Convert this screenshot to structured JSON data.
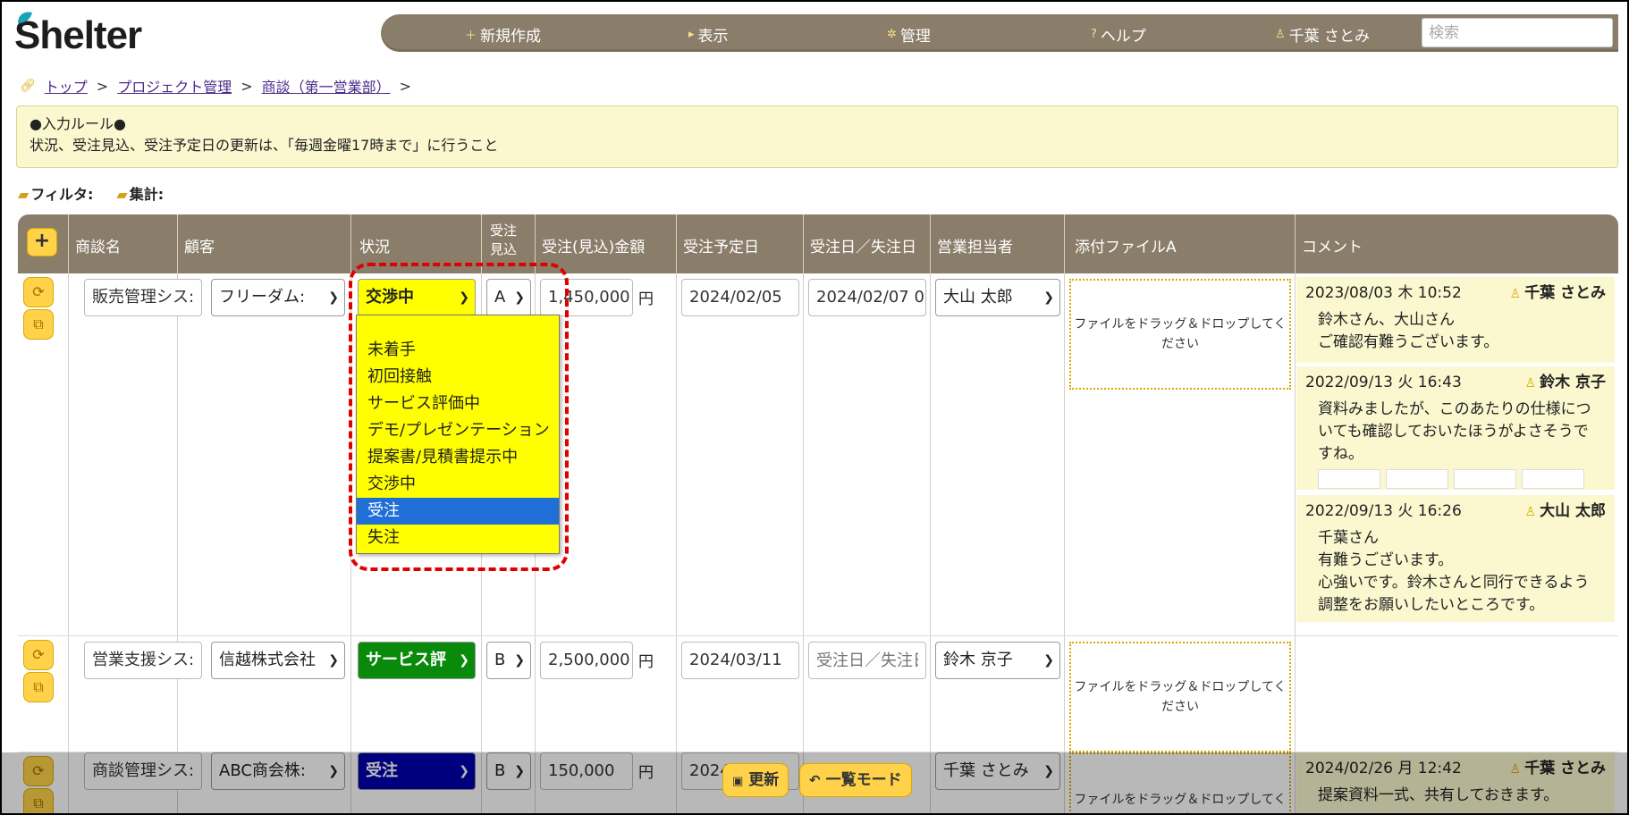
{
  "header": {
    "logo": "Shelter",
    "nav": [
      {
        "icon": "plus-icon",
        "label": "新規作成"
      },
      {
        "icon": "triangle-right-icon",
        "label": "表示"
      },
      {
        "icon": "gear-icon",
        "label": "管理"
      },
      {
        "icon": "question-icon",
        "label": "ヘルプ"
      },
      {
        "icon": "user-icon",
        "label": "千葉 さとみ"
      }
    ],
    "search_placeholder": "検索"
  },
  "breadcrumb": [
    "トップ",
    "プロジェクト管理",
    "商談（第一営業部）"
  ],
  "rules": {
    "title": "●入力ルール●",
    "text": "状況、受注見込、受注予定日の更新は、「毎週金曜17時まで」に行うこと"
  },
  "tools": {
    "filter": "フィルタ:",
    "summary": "集計:"
  },
  "table": {
    "add_label": "+",
    "columns": [
      "商談名",
      "顧客",
      "状況",
      "受注見込",
      "受注(見込)金額",
      "受注予定日",
      "受注日／失注日",
      "営業担当者",
      "添付ファイルA",
      "コメント"
    ],
    "col_prob_1": "受注",
    "col_prob_2": "見込",
    "rows": [
      {
        "name": "販売管理シス:",
        "customer": "フリーダム:",
        "status": "交渉中",
        "prob": "A",
        "amount": "1,450,000",
        "currency": "円",
        "planned": "2024/02/05",
        "closed": "2024/02/07 0(",
        "owner": "大山 太郎",
        "dropzone": "ファイルをドラッグ＆ドロップしてください",
        "comments": [
          {
            "date": "2023/08/03 木 10:52",
            "user": "千葉 さとみ",
            "lines": [
              "鈴木さん、大山さん",
              "ご確認有難うございます。"
            ]
          },
          {
            "date": "2022/09/13 火 16:43",
            "user": "鈴木 京子",
            "lines": [
              "資料みましたが、このあたりの仕様につ",
              "いても確認しておいたほうがよさそうで",
              "すね。"
            ]
          },
          {
            "date": "2022/09/13 火 16:26",
            "user": "大山 太郎",
            "lines": [
              "千葉さん",
              "有難うございます。",
              "心強いです。鈴木さんと同行できるよう",
              "調整をお願いしたいところです。"
            ]
          }
        ]
      },
      {
        "name": "営業支援シス:",
        "customer": "信越株式会社",
        "status": "サービス評",
        "prob": "B",
        "amount": "2,500,000",
        "currency": "円",
        "planned": "2024/03/11",
        "closed_placeholder": "受注日／失注日",
        "owner": "鈴木 京子",
        "dropzone": "ファイルをドラッグ＆ドロップしてください"
      },
      {
        "name": "商談管理シス:",
        "customer": "ABC商会株:",
        "status": "受注",
        "prob": "B",
        "amount": "150,000",
        "currency": "円",
        "planned": "2024",
        "owner": "千葉 さとみ",
        "dropzone": "ファイルをドラッグ＆ドロップしてくださ",
        "comment_date": "2024/02/26 月 12:42",
        "comment_user": "千葉 さとみ",
        "comment_line": "提案資料一式、共有しておきます。"
      }
    ]
  },
  "status_dropdown": {
    "options": [
      "未着手",
      "初回接触",
      "サービス評価中",
      "デモ/プレゼンテーション",
      "提案書/見積書提示中",
      "交渉中",
      "受注",
      "失注"
    ],
    "highlighted": "受注"
  },
  "bottom_bar": {
    "update": "更新",
    "list_mode": "一覧モード"
  },
  "colors": {
    "header_bg": "#8a7d6a",
    "accent": "#ffd24a",
    "note_bg": "#fbf8cf",
    "status_yellow": "#ffff00",
    "status_green": "#0a8a0a",
    "status_blue": "#0000b0",
    "highlight": "#e10000"
  }
}
